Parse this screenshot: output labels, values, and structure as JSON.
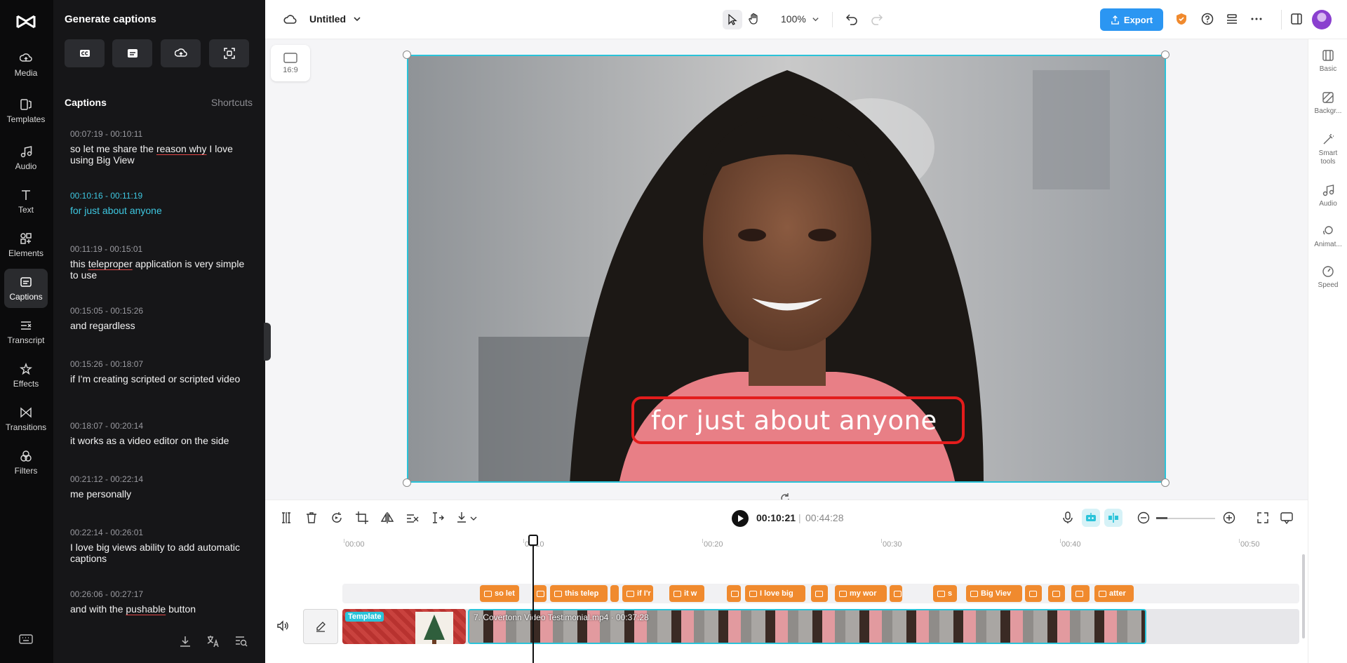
{
  "app": {
    "name": "CapCut",
    "rail": [
      {
        "label": "Media",
        "icon": "cloud-upload-icon"
      },
      {
        "label": "Templates",
        "icon": "templates-icon"
      },
      {
        "label": "Audio",
        "icon": "music-note-icon"
      },
      {
        "label": "Text",
        "icon": "text-icon"
      },
      {
        "label": "Elements",
        "icon": "elements-icon"
      },
      {
        "label": "Captions",
        "icon": "captions-icon",
        "active": true
      },
      {
        "label": "Transcript",
        "icon": "transcript-icon"
      },
      {
        "label": "Effects",
        "icon": "effects-icon"
      },
      {
        "label": "Transitions",
        "icon": "transitions-icon"
      },
      {
        "label": "Filters",
        "icon": "filters-icon"
      }
    ]
  },
  "panel": {
    "title": "Generate captions",
    "captions_heading": "Captions",
    "shortcuts_label": "Shortcuts",
    "captions": [
      {
        "time": "00:07:19 - 00:10:11",
        "text": "so let me share the reason why I love using Big View"
      },
      {
        "time": "00:10:16 - 00:11:19",
        "text": "for just about anyone",
        "active": true
      },
      {
        "time": "00:11:19 - 00:15:01",
        "text": "this teleproper application is very simple to use"
      },
      {
        "time": "00:15:05 - 00:15:26",
        "text": "and regardless"
      },
      {
        "time": "00:15:26 - 00:18:07",
        "text": "if I'm creating scripted or scripted video"
      },
      {
        "time": "00:18:07 - 00:20:14",
        "text": "it works as a video editor on the side"
      },
      {
        "time": "00:21:12 - 00:22:14",
        "text": "me personally"
      },
      {
        "time": "00:22:14 - 00:26:01",
        "text": "I love big views ability to add automatic captions"
      },
      {
        "time": "00:26:06 - 00:27:17",
        "text": "and with the pushable button"
      }
    ]
  },
  "topbar": {
    "project_name": "Untitled",
    "zoom": "100%",
    "export_label": "Export"
  },
  "canvas": {
    "aspect_ratio": "16:9",
    "caption_text": "for just about anyone"
  },
  "rightbar": [
    {
      "label": "Basic",
      "icon": "basic-icon"
    },
    {
      "label": "Backgr...",
      "icon": "background-icon"
    },
    {
      "label": "Smart tools",
      "icon": "smart-tools-icon"
    },
    {
      "label": "Audio",
      "icon": "audio-icon"
    },
    {
      "label": "Animat...",
      "icon": "animation-icon"
    },
    {
      "label": "Speed",
      "icon": "speed-icon"
    }
  ],
  "player": {
    "current_time": "00:10:21",
    "separator": "|",
    "total_time": "00:44:28"
  },
  "timeline": {
    "ticks": [
      "00:00",
      "00:10",
      "00:20",
      "00:30",
      "00:40",
      "00:50"
    ],
    "caption_clips": [
      "so let",
      "",
      "this telep",
      "",
      "if I'r",
      "it w",
      "",
      "I love big",
      "",
      "my wor",
      "",
      "s",
      "Big Viev",
      "",
      "",
      "",
      "atter"
    ],
    "template_label": "Template",
    "video_clip_label": "7. Covertonn Video Testimonial.mp4 · 00:37:28"
  },
  "colors": {
    "accent": "#2ac3d9",
    "export": "#2b96f2",
    "caption_clip": "#f08a2e",
    "active_caption": "#3ec7e0",
    "highlight_box": "#e31c1c"
  }
}
